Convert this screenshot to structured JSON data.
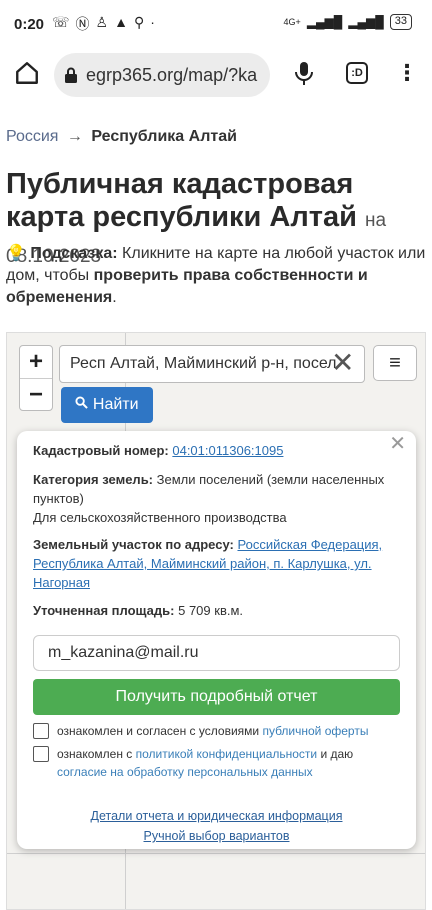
{
  "status_bar": {
    "time": "0:20",
    "network": "4G+",
    "battery": "33"
  },
  "browser": {
    "url": "egrp365.org/map/?ka",
    "tab_count": ":D"
  },
  "breadcrumb": {
    "root": "Россия",
    "arrow": "→",
    "current": "Республика Алтай"
  },
  "page": {
    "title": "Публичная кадастровая карта республики Алтай",
    "date": "на 08.10.2023",
    "hint_icon": "💡",
    "hint_label": "Подсказка:",
    "hint_text1": "Кликните на карте на любой участок или дом, чтобы",
    "hint_bold": "проверить права собственности и обременения",
    "hint_end": "."
  },
  "map": {
    "zoom_in": "+",
    "zoom_out": "−",
    "search_value": "Респ Алтай, Майминский р-н, посел",
    "clear": "✕",
    "menu": "≡",
    "find_label": "Найти"
  },
  "popup": {
    "close": "✕",
    "cadastral_label": "Кадастровый номер:",
    "cadastral_number": "04:01:011306:1095",
    "category_label": "Категория земель:",
    "category_value": "Земли поселений (земли населенных пунктов)",
    "usage": "Для сельскохозяйственного производства",
    "address_label": "Земельный участок по адресу:",
    "address_value": "Российская Федерация, Республика Алтай, Майминский район, п. Карлушка, ул. Нагорная",
    "area_label": "Уточненная площадь:",
    "area_value": "5 709 кв.м.",
    "email_value": "m_kazanina@mail.ru",
    "report_button": "Получить подробный отчет",
    "check1_text": "ознакомлен и согласен с условиями",
    "check1_link": "публичной оферты",
    "check2_text": "ознакомлен с",
    "check2_link": "политикой конфиденциальности",
    "check2_mid": "и даю",
    "check2_link2": "согласие на обработку персональных данных",
    "details_link": "Детали отчета и юридическая информация",
    "manual_link": "Ручной выбор вариантов"
  }
}
